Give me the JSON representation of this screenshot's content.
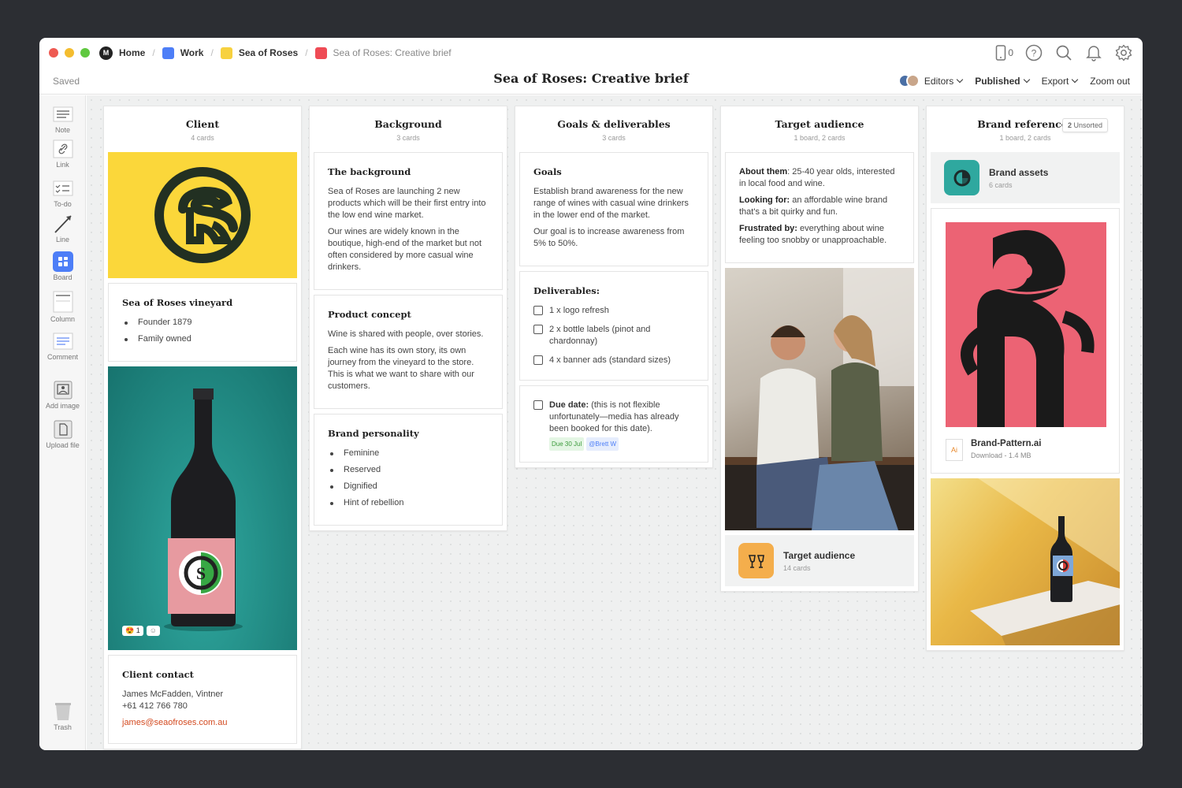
{
  "window": {
    "dots": [
      "#ee5a52",
      "#f4bd2f",
      "#5fc83f"
    ],
    "breadcrumbs": [
      {
        "label": "Home",
        "icon": "milanote-logo-icon"
      },
      {
        "label": "Work",
        "color": "#4d7ef7"
      },
      {
        "label": "Sea of Roses",
        "color": "#f7d13f"
      },
      {
        "label": "Sea of Roses: Creative brief",
        "color": "#ef4b55"
      }
    ],
    "phone_count": "0"
  },
  "subbar": {
    "saved": "Saved",
    "title": "Sea of Roses: Creative brief",
    "editors": "Editors",
    "published": "Published",
    "export": "Export",
    "zoom_out": "Zoom out"
  },
  "toolbar": {
    "items": [
      "Note",
      "Link",
      "To-do",
      "Line",
      "Board",
      "Column",
      "Comment",
      "Add image",
      "Upload file"
    ],
    "trash": "Trash"
  },
  "columns": {
    "client": {
      "title": "Client",
      "count": "4 cards",
      "vineyard_title": "Sea of Roses vineyard",
      "vineyard_items": [
        "Founder 1879",
        "Family owned"
      ],
      "reaction_count": "1",
      "contact_title": "Client contact",
      "contact_name": "James McFadden, Vintner",
      "contact_phone": "+61 412 766 780",
      "contact_email": "james@seaofroses.com.au"
    },
    "background": {
      "title": "Background",
      "count": "3 cards",
      "bg_title": "The background",
      "bg_p1": "Sea of Roses are launching 2 new products which will be their first entry into the low end wine market.",
      "bg_p2": "Our wines are widely known in the boutique, high-end of the market but not often considered by more casual wine drinkers.",
      "concept_title": "Product concept",
      "concept_p1": "Wine is shared with people, over stories.",
      "concept_p2": "Each wine has its own story, its own journey from the vineyard to the store. This is what we want to share with our customers.",
      "personality_title": "Brand personality",
      "personality_items": [
        "Feminine",
        "Reserved",
        "Dignified",
        "Hint of rebellion"
      ]
    },
    "goals": {
      "title": "Goals & deliverables",
      "count": "3 cards",
      "goals_title": "Goals",
      "goals_p1": "Establish brand awareness for the new range of wines with casual wine drinkers in the lower end of the market.",
      "goals_p2": "Our goal is to increase awareness from 5% to 50%.",
      "deliverables_title": "Deliverables:",
      "deliverables": [
        "1 x logo refresh",
        "2 x bottle labels (pinot and chardonnay)",
        "4 x banner ads (standard sizes)"
      ],
      "due_label": "Due date:",
      "due_text": " (this is not flexible unfortunately—media has already been booked for this date).",
      "due_tag": "Due 30 Jul",
      "mention_tag": "@Brett W"
    },
    "audience": {
      "title": "Target audience",
      "count": "1 board, 2 cards",
      "about_label": "About them",
      "about_text": ": 25-40 year olds, interested in local food and wine.",
      "looking_label": "Looking for:",
      "looking_text": " an affordable wine brand that's a bit quirky and fun.",
      "frustrated_label": "Frustrated by:",
      "frustrated_text": " everything about wine feeling too snobby or unapproachable.",
      "board_title": "Target audience",
      "board_count": "14 cards"
    },
    "references": {
      "title": "Brand references",
      "count": "1 board, 2 cards",
      "unsorted_count": "2",
      "unsorted_label": " Unsorted",
      "board_title": "Brand assets",
      "board_count": "6 cards",
      "file_badge": "Ai",
      "file_name": "Brand-Pattern.ai",
      "file_download": "Download",
      "file_size": " - 1.4 MB"
    }
  }
}
